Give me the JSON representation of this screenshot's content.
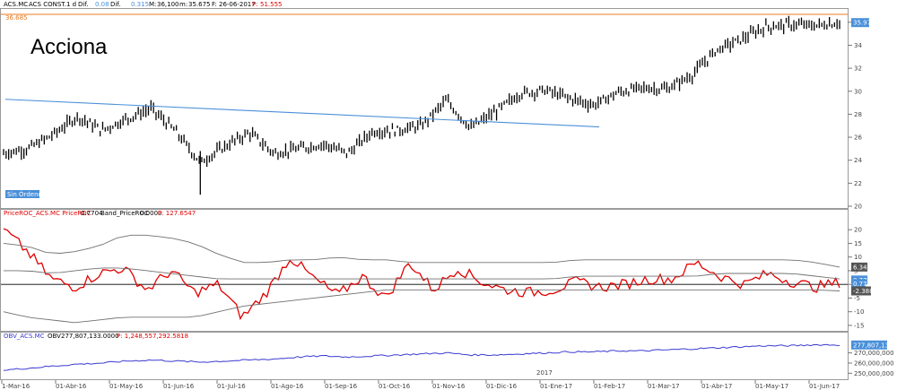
{
  "header": {
    "top_ticker": "ACS.MC",
    "top_name": "ACS CONST.",
    "top_interval": "1 d",
    "top_dif_label": "Dif.",
    "top_dif": "0.08",
    "top_difpct_label": "Dif.",
    "top_difpct": "0.315",
    "top_max_label": "M:",
    "top_max": "36,100",
    "top_min_label": "m:",
    "top_min": "35.675",
    "top_date_label": "F:",
    "top_date": "26-06-2017",
    "top_price_label": "P:",
    "top_price": "51.555",
    "roc_title": "PriceROC_ACS.MC PriceROC",
    "roc_val1": "0.7704",
    "roc_band_label": "Band_PriceROC",
    "roc_val2": "0.0000",
    "roc_p": "P: 127.6547",
    "obv_title": "OBV_ACS.MC",
    "obv_label": "OBV",
    "obv_val": "277,807,133.0000",
    "obv_p": "P: 1,248,557,292.5818"
  },
  "labels": {
    "company": "Acciona",
    "sin_ordenes": "Sin Órdenes",
    "resistance": "36.685",
    "last_price": "35.97",
    "roc_last1": "6.34",
    "roc_last2": "0.770",
    "roc_last3": "0.77",
    "roc_last4": "-2.388",
    "obv_last": "277,807,133",
    "year_marker": "2017"
  },
  "colors": {
    "bars": "#000000",
    "trendline": "#4a90d9",
    "resistance": "#e8781e",
    "roc_line": "#e00000",
    "bands": "#707070",
    "obv_line": "#3a3ad0",
    "badge": "#4a90d9"
  },
  "chart_data": [
    {
      "type": "ohlc",
      "title": "Acciona",
      "series": [
        {
          "name": "ACS.MC",
          "dates": [
            "2016-03-01",
            "2016-03-15",
            "2016-04-01",
            "2016-04-15",
            "2016-05-01",
            "2016-05-15",
            "2016-06-01",
            "2016-06-15",
            "2016-06-24",
            "2016-07-01",
            "2016-07-15",
            "2016-08-01",
            "2016-08-15",
            "2016-09-01",
            "2016-09-15",
            "2016-10-01",
            "2016-10-15",
            "2016-11-01",
            "2016-11-10",
            "2016-11-15",
            "2016-12-01",
            "2016-12-15",
            "2017-01-01",
            "2017-01-15",
            "2017-02-01",
            "2017-02-15",
            "2017-03-01",
            "2017-03-15",
            "2017-04-01",
            "2017-04-15",
            "2017-05-01",
            "2017-05-15",
            "2017-06-01",
            "2017-06-15",
            "2017-06-26"
          ],
          "close": [
            24.6,
            25.0,
            26.2,
            27.8,
            26.6,
            27.6,
            28.5,
            26.5,
            23.8,
            25.2,
            26.4,
            24.6,
            25.0,
            25.4,
            24.6,
            26.5,
            26.6,
            27.0,
            29.2,
            26.8,
            28.2,
            29.8,
            30.1,
            29.4,
            28.8,
            29.9,
            30.3,
            30.2,
            31.4,
            33.6,
            34.5,
            35.6,
            35.8,
            35.7,
            35.97
          ]
        }
      ],
      "annotations": {
        "trendline_start": 29.3,
        "trendline_end": 26.9,
        "resistance": 36.685
      },
      "xlabels": [
        "1-Mar-16",
        "01-Abr-16",
        "01-May-16",
        "01-Jun-16",
        "01-Jul-16",
        "01-Ago-16",
        "01-Sep-16",
        "01-Oct-16",
        "01-Nov-16",
        "01-Dic-16",
        "01-Ene-17",
        "01-Feb-17",
        "01-Mar-17",
        "01-Abr-17",
        "01-May-17",
        "01-Jun-17"
      ],
      "ylim": [
        20,
        37
      ],
      "yticks": [
        20,
        22,
        24,
        26,
        28,
        30,
        32,
        34,
        36
      ]
    },
    {
      "type": "line",
      "series": [
        {
          "name": "PriceROC",
          "values": [
            20,
            12,
            2,
            -1,
            4,
            6,
            -2,
            5,
            -3,
            0,
            -12,
            -3,
            10,
            2,
            -4,
            3,
            -5,
            8,
            -2,
            6,
            1,
            -2,
            -3,
            -2,
            1,
            -1,
            0,
            2,
            2,
            8,
            3,
            0,
            4,
            1,
            -1,
            0.77
          ]
        },
        {
          "name": "Band upper",
          "values": [
            15,
            14,
            11,
            12,
            14,
            18,
            18,
            17,
            15,
            11,
            8,
            8,
            9,
            9,
            10,
            9,
            9,
            8,
            8,
            8,
            8,
            8,
            8,
            8,
            9,
            9,
            9,
            9,
            9,
            9,
            9,
            9,
            9,
            9,
            8,
            6.34
          ]
        },
        {
          "name": "Band mid",
          "values": [
            5,
            5,
            4,
            5,
            6,
            6,
            5,
            4,
            3,
            2,
            2,
            2,
            2,
            2,
            2,
            2,
            2,
            2,
            2,
            2,
            2,
            2,
            2,
            2,
            3,
            3,
            3,
            3,
            3,
            3,
            4,
            4,
            4,
            4,
            3,
            2
          ]
        },
        {
          "name": "Band lower",
          "values": [
            -10,
            -12,
            -13,
            -14,
            -13,
            -12,
            -12,
            -12,
            -12,
            -10,
            -8,
            -7,
            -6,
            -5,
            -4,
            -3,
            -2,
            -2,
            -2,
            -2,
            -2,
            -2,
            -2,
            -2,
            -2,
            -2,
            -2,
            -2,
            -2,
            -2,
            -2,
            -2,
            -2,
            -2,
            -2,
            -2.388
          ]
        }
      ],
      "ylim": [
        -16,
        24
      ],
      "yticks": [
        -15,
        -10,
        -5,
        0,
        5,
        10,
        15,
        20
      ]
    },
    {
      "type": "line",
      "series": [
        {
          "name": "OBV",
          "values": [
            253,
            255,
            257,
            259,
            260,
            262,
            263,
            262,
            261,
            262,
            263,
            264,
            266,
            267,
            266,
            267,
            268,
            269,
            270,
            268,
            268,
            269,
            270,
            271,
            271,
            272,
            272,
            273,
            274,
            275,
            276,
            277,
            277,
            278,
            277.8
          ]
        }
      ],
      "ylim": [
        245,
        282
      ],
      "yticks": [
        250,
        260,
        270
      ],
      "ytick_labels": [
        "250,000,000",
        "260,000,000",
        "270,000,000"
      ]
    }
  ]
}
